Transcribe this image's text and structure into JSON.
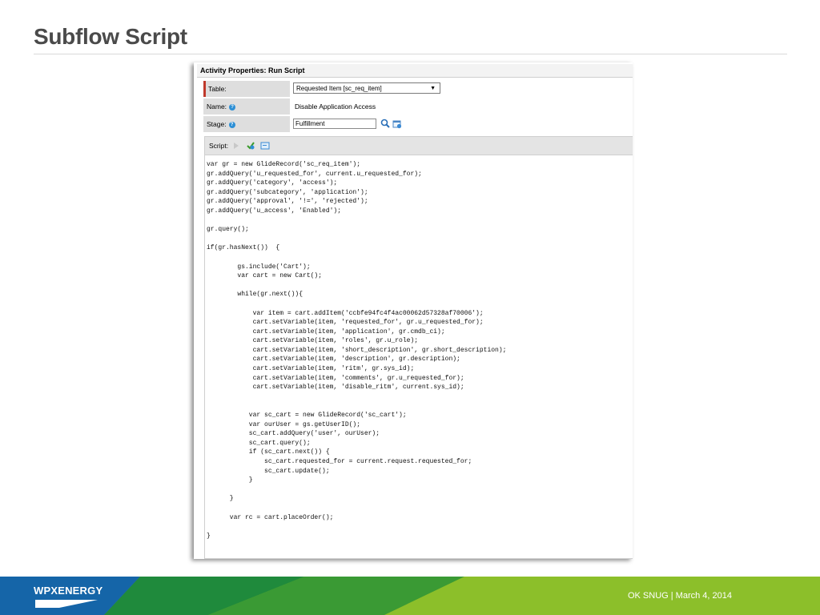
{
  "slide": {
    "title": "Subflow Script",
    "footer_text": "OK SNUG  |  March 4, 2014",
    "logo_text": "WPXENERGY"
  },
  "panel": {
    "header": "Activity Properties: Run Script",
    "fields": [
      {
        "label": "Table:",
        "value": "Requested Item [sc_req_item]"
      },
      {
        "label": "Name:",
        "value": "Disable Application Access"
      },
      {
        "label": "Stage:",
        "value": "Fulfillment"
      }
    ],
    "script_label": "Script:"
  },
  "script": {
    "lines": [
      "var gr = new GlideRecord('sc_req_item');",
      "gr.addQuery('u_requested_for', current.u_requested_for);",
      "gr.addQuery('category', 'access');",
      "gr.addQuery('subcategory', 'application');",
      "gr.addQuery('approval', '!=', 'rejected');",
      "gr.addQuery('u_access', 'Enabled');",
      "",
      "gr.query();",
      "",
      "if(gr.hasNext())  {",
      "",
      "        gs.include('Cart');",
      "        var cart = new Cart();",
      "",
      "        while(gr.next()){",
      "",
      "            var item = cart.addItem('ccbfe94fc4f4ac00062d57328af70006');",
      "            cart.setVariable(item, 'requested_for', gr.u_requested_for);",
      "            cart.setVariable(item, 'application', gr.cmdb_ci);",
      "            cart.setVariable(item, 'roles', gr.u_role);",
      "            cart.setVariable(item, 'short_description', gr.short_description);",
      "            cart.setVariable(item, 'description', gr.description);",
      "            cart.setVariable(item, 'ritm', gr.sys_id);",
      "            cart.setVariable(item, 'comments', gr.u_requested_for);",
      "            cart.setVariable(item, 'disable_ritm', current.sys_id);",
      "",
      "",
      "           var sc_cart = new GlideRecord('sc_cart');",
      "           var ourUser = gs.getUserID();",
      "           sc_cart.addQuery('user', ourUser);",
      "           sc_cart.query();",
      "           if (sc_cart.next()) {",
      "               sc_cart.requested_for = current.request.requested_for;",
      "               sc_cart.update();",
      "           }",
      "",
      "      }",
      "",
      "      var rc = cart.placeOrder();",
      "",
      "}"
    ]
  },
  "colors": {
    "title": "#4a4a4a",
    "footer_green": "#5aa22c",
    "footer_blue": "#1565a8",
    "mandatory_marker": "#c0392b"
  },
  "icons": [
    "help-icon",
    "search-icon",
    "reference-icon",
    "script-toggle-icon",
    "script-run-icon",
    "script-fullscreen-icon",
    "logo"
  ]
}
